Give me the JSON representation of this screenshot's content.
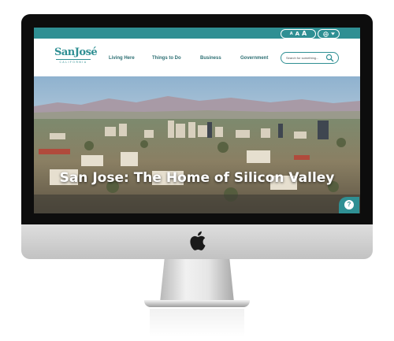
{
  "utility_bar": {
    "font_size_buttons": [
      "A",
      "A",
      "A"
    ],
    "language_icon": "globe-icon",
    "language_chevron": "chevron-down-icon"
  },
  "header": {
    "logo": {
      "main": "SanJosé",
      "sub": "CALIFORNIA"
    },
    "nav": [
      "Living Here",
      "Things to Do",
      "Business",
      "Government"
    ],
    "search": {
      "placeholder": "Search for something...",
      "icon": "search-icon"
    }
  },
  "hero": {
    "title": "San Jose: The Home of Silicon Valley"
  },
  "help_button": {
    "label": "?",
    "icon": "help-icon"
  },
  "colors": {
    "brand_teal": "#2f8f93",
    "nav_text": "#2d6f73",
    "bezel": "#0d0d0d"
  }
}
